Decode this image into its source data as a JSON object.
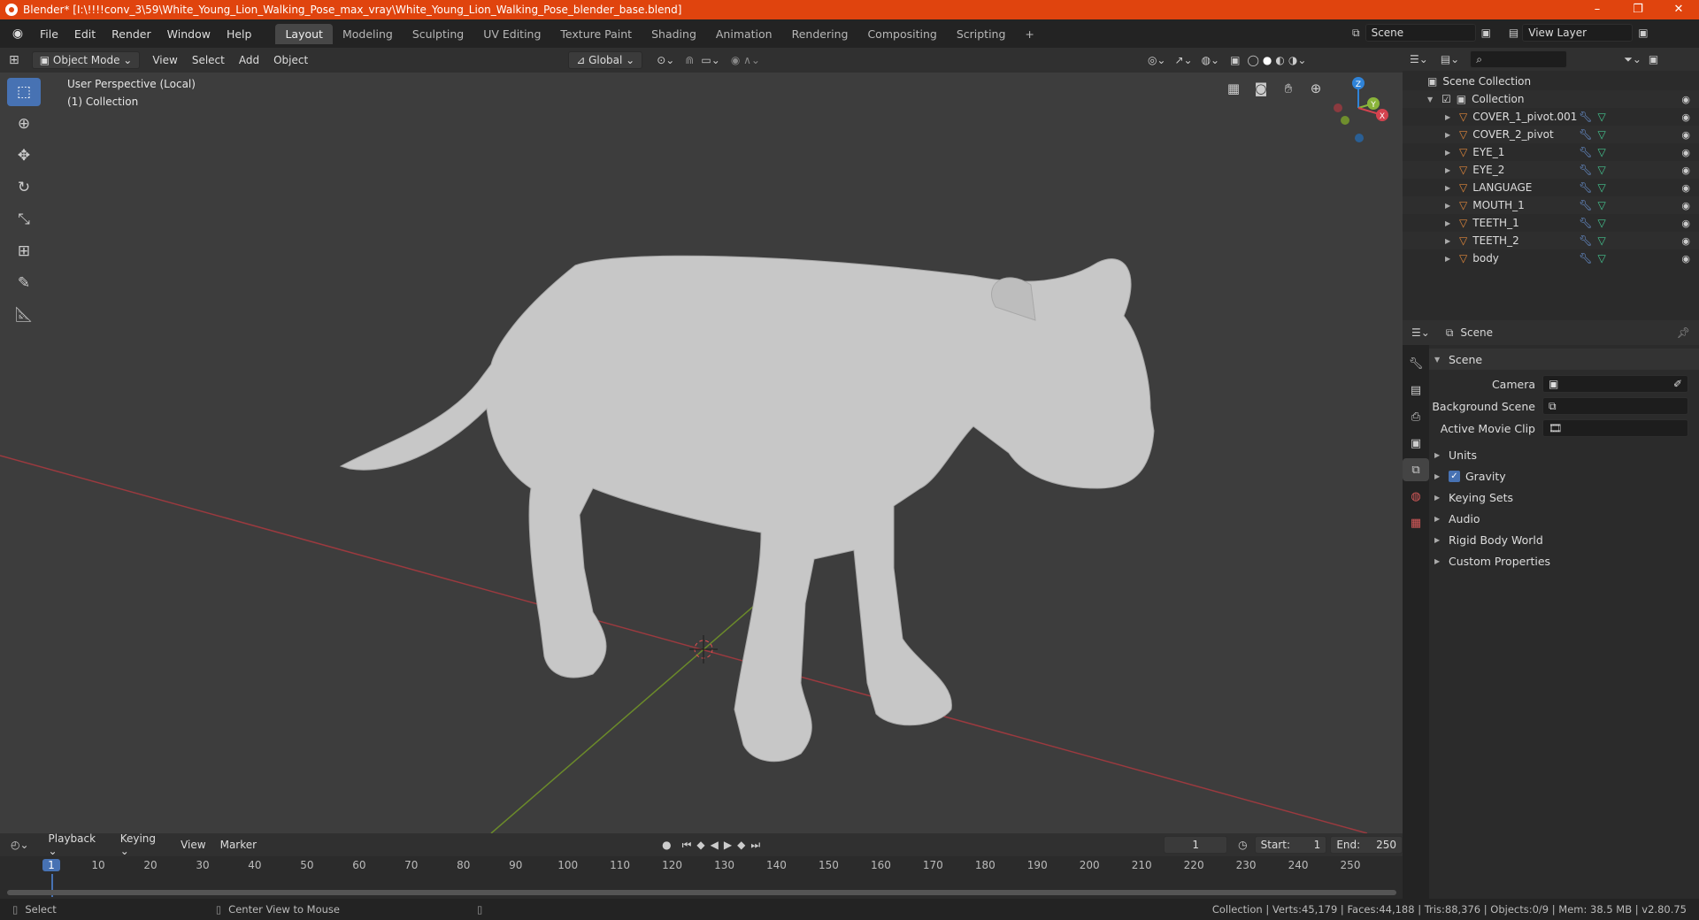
{
  "window": {
    "title": "Blender* [I:\\!!!!conv_3\\59\\White_Young_Lion_Walking_Pose_max_vray\\White_Young_Lion_Walking_Pose_blender_base.blend]",
    "minimize": "–",
    "maximize": "❐",
    "close": "✕"
  },
  "menu": {
    "file": "File",
    "edit": "Edit",
    "render": "Render",
    "window": "Window",
    "help": "Help"
  },
  "workspaces": [
    "Layout",
    "Modeling",
    "Sculpting",
    "UV Editing",
    "Texture Paint",
    "Shading",
    "Animation",
    "Rendering",
    "Compositing",
    "Scripting"
  ],
  "workspace_add": "+",
  "scene_field": "Scene",
  "view_layer_field": "View Layer",
  "viewport_header": {
    "mode": "Object Mode",
    "view": "View",
    "select": "Select",
    "add": "Add",
    "object": "Object",
    "orientation": "Global"
  },
  "viewport": {
    "perspective": "User Perspective (Local)",
    "collection": "(1) Collection",
    "gizmo": {
      "z": "Z",
      "y": "Y",
      "x": "X"
    }
  },
  "outliner": {
    "scene_collection": "Scene Collection",
    "collection": "Collection",
    "items": [
      "COVER_1_pivot.001",
      "COVER_2_pivot",
      "EYE_1",
      "EYE_2",
      "LANGUAGE",
      "MOUTH_1",
      "TEETH_1",
      "TEETH_2",
      "body"
    ]
  },
  "properties": {
    "header": "Scene",
    "section": "Scene",
    "camera_label": "Camera",
    "background_label": "Background Scene",
    "clip_label": "Active Movie Clip",
    "panels": [
      "Units",
      "Gravity",
      "Keying Sets",
      "Audio",
      "Rigid Body World",
      "Custom Properties"
    ],
    "gravity_checked": true
  },
  "timeline": {
    "playback": "Playback",
    "keying": "Keying",
    "view": "View",
    "marker": "Marker",
    "current_frame": "1",
    "start_label": "Start:",
    "start": "1",
    "end_label": "End:",
    "end": "250",
    "ticks": [
      "1",
      "10",
      "20",
      "30",
      "40",
      "50",
      "60",
      "70",
      "80",
      "90",
      "100",
      "110",
      "120",
      "130",
      "140",
      "150",
      "160",
      "170",
      "180",
      "190",
      "200",
      "210",
      "220",
      "230",
      "240",
      "250"
    ]
  },
  "status": {
    "select": "Select",
    "center_view": "Center View to Mouse",
    "stats": "Collection | Verts:45,179 | Faces:44,188 | Tris:88,376 | Objects:0/9 | Mem: 38.5 MB | v2.80.75"
  },
  "colors": {
    "accent": "#4772b3",
    "title_bar": "#e0440e",
    "x_axis": "#d4424e",
    "y_axis": "#8ab43a",
    "z_axis": "#2f83d8"
  }
}
